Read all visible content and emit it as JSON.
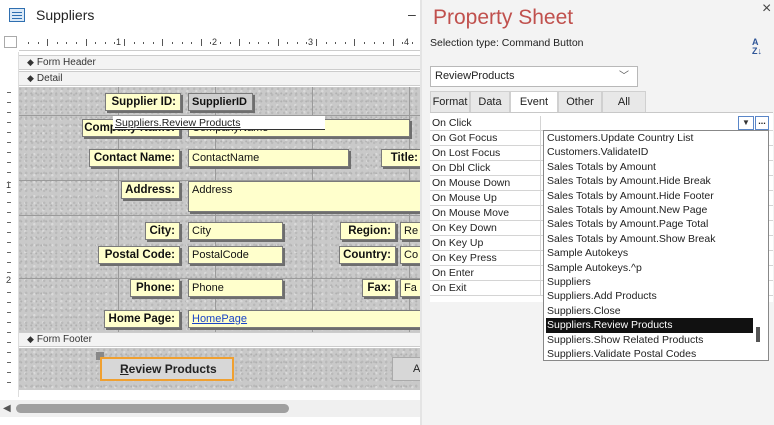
{
  "window": {
    "title": "Suppliers",
    "minimize": "–"
  },
  "ruler": {
    "numbers": [
      "1",
      "2",
      "3",
      "4"
    ],
    "vnumbers": [
      "1",
      "2"
    ]
  },
  "sections": {
    "form_header": "Form Header",
    "detail": "Detail",
    "form_footer": "Form Footer"
  },
  "form": {
    "supplier_id_label": "Supplier ID:",
    "supplier_id_field": "SupplierID",
    "company_label": "Company Name:",
    "company_field": "CompanyName",
    "contact_label": "Contact Name:",
    "contact_field": "ContactName",
    "title_label": "Title:",
    "address_label": "Address:",
    "address_field": "Address",
    "city_label": "City:",
    "city_field": "City",
    "region_label": "Region:",
    "region_field": "Re",
    "postal_label": "Postal Code:",
    "postal_field": "PostalCode",
    "country_label": "Country:",
    "country_field": "Co",
    "phone_label": "Phone:",
    "phone_field": "Phone",
    "fax_label": "Fax:",
    "fax_field": "Fa",
    "homepage_label": "Home Page:",
    "homepage_field": "HomePage"
  },
  "footer": {
    "review_button_first": "R",
    "review_button_rest": "eview Products",
    "right_button": "A"
  },
  "property_sheet": {
    "title": "Property Sheet",
    "selection_type": "Selection type:  Command Button",
    "sort_icon_top": "A",
    "sort_icon_bottom": "Z↓",
    "close": "×",
    "selected_object": "ReviewProducts",
    "tabs": [
      "Format",
      "Data",
      "Event",
      "Other",
      "All"
    ],
    "active_tab": "Event",
    "events": [
      "On Click",
      "On Got Focus",
      "On Lost Focus",
      "On Dbl Click",
      "On Mouse Down",
      "On Mouse Up",
      "On Mouse Move",
      "On Key Down",
      "On Key Up",
      "On Key Press",
      "On Enter",
      "On Exit"
    ],
    "on_click_value": "Suppliers.Review Products",
    "build_button": "...",
    "dropdown_items": [
      "Customers.Update Country List",
      "Customers.ValidateID",
      "Sales Totals by Amount",
      "Sales Totals by Amount.Hide Break",
      "Sales Totals by Amount.Hide Footer",
      "Sales Totals by Amount.New Page",
      "Sales Totals by Amount.Page Total",
      "Sales Totals by Amount.Show Break",
      "Sample Autokeys",
      "Sample Autokeys.^p",
      "Suppliers",
      "Suppliers.Add Products",
      "Suppliers.Close",
      "Suppliers.Review Products",
      "Suppliers.Show Related Products",
      "Suppliers.Validate Postal Codes"
    ],
    "dropdown_selected": "Suppliers.Review Products"
  }
}
